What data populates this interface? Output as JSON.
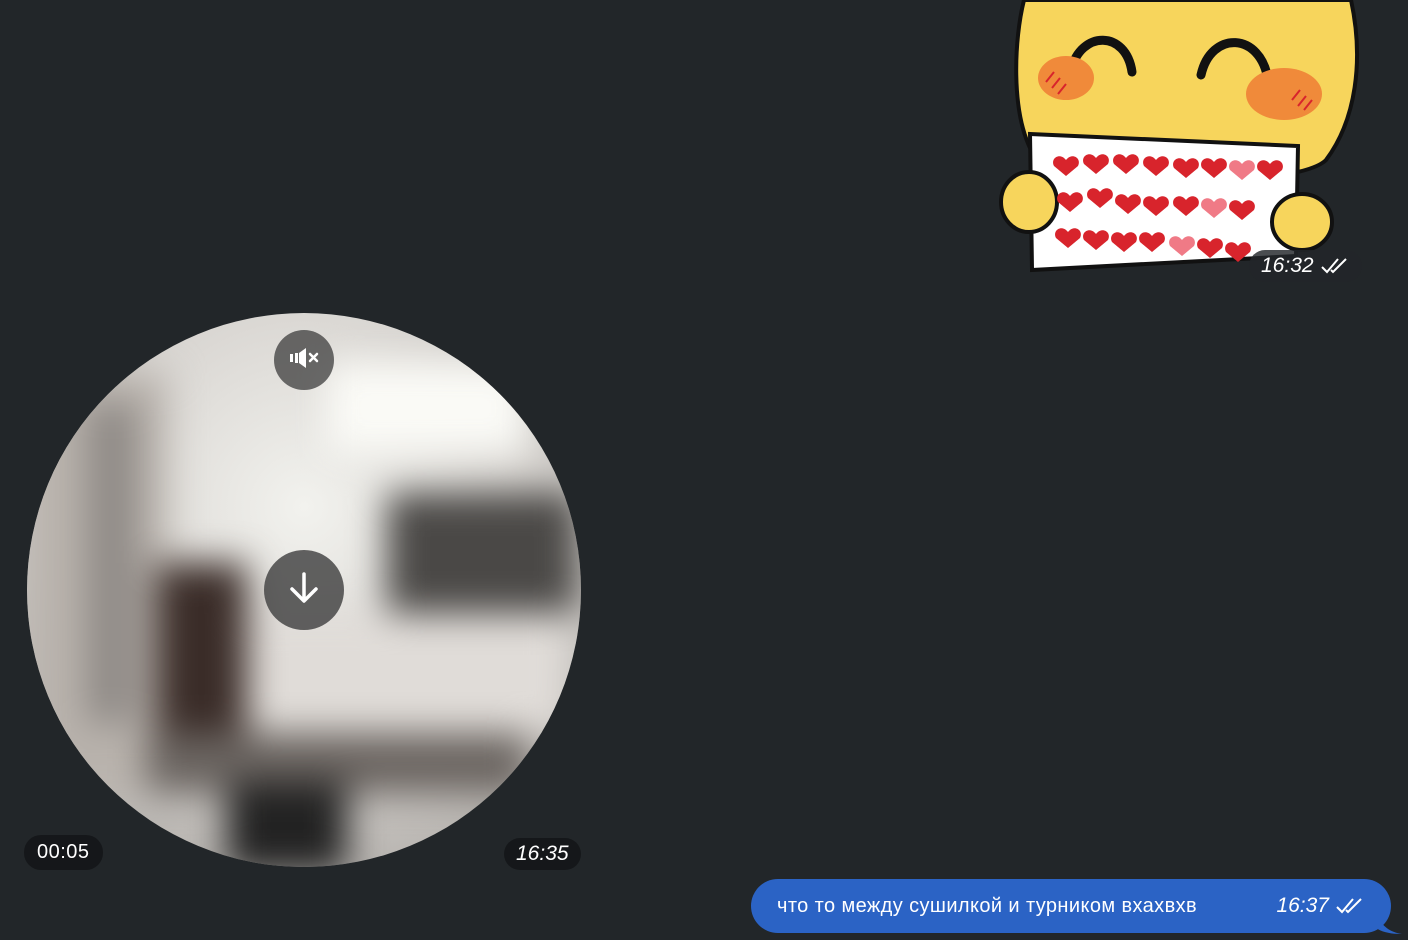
{
  "sticker_message": {
    "time": "16:32",
    "status_icon": "double-check-icon"
  },
  "video_message": {
    "duration": "00:05",
    "time": "16:35",
    "mute_icon": "muted-speaker-icon",
    "download_icon": "download-arrow-icon"
  },
  "text_message": {
    "text": "что то между сушилкой и турником вхахвхв",
    "time": "16:37",
    "status_icon": "double-check-icon"
  },
  "colors": {
    "background": "#222629",
    "outgoing_bubble": "#2b63c5",
    "sticker_face": "#f7d55c",
    "sticker_cheek": "#f08a3a",
    "heart": "#d8242c"
  }
}
